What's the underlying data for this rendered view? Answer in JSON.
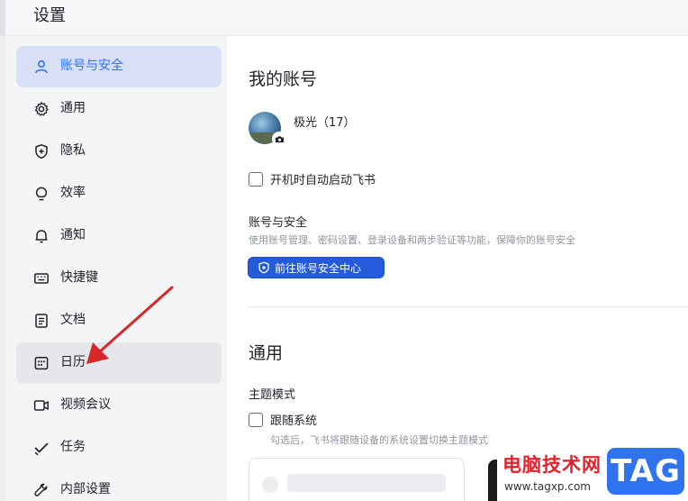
{
  "header": {
    "title": "设置"
  },
  "sidebar": {
    "items": [
      {
        "label": "账号与安全",
        "icon": "user-icon",
        "state": "active"
      },
      {
        "label": "通用",
        "icon": "gear-icon"
      },
      {
        "label": "隐私",
        "icon": "shield-icon"
      },
      {
        "label": "效率",
        "icon": "lightbulb-icon"
      },
      {
        "label": "通知",
        "icon": "bell-icon"
      },
      {
        "label": "快捷键",
        "icon": "keyboard-icon"
      },
      {
        "label": "文档",
        "icon": "document-icon"
      },
      {
        "label": "日历",
        "icon": "calendar-icon",
        "state": "hover"
      },
      {
        "label": "视频会议",
        "icon": "video-icon"
      },
      {
        "label": "任务",
        "icon": "checkmark-icon"
      },
      {
        "label": "内部设置",
        "icon": "wrench-icon"
      }
    ]
  },
  "account": {
    "section_title": "我的账号",
    "username": "极光（17）",
    "autostart_label": "开机时自动启动飞书",
    "security_title": "账号与安全",
    "security_desc": "使用账号管理、密码设置、登录设备和两步验证等功能，保障你的账号安全",
    "security_button": "前往账号安全中心"
  },
  "general": {
    "section_title": "通用",
    "theme_title": "主题模式",
    "follow_system_label": "跟随系统",
    "follow_system_desc": "勾选后，飞书将跟随设备的系统设置切换主题模式"
  },
  "watermark": {
    "title": "电脑技术网",
    "url": "www.tagxp.com",
    "logo": "TAG"
  },
  "colors": {
    "accent": "#3370ff",
    "button": "#245bdb",
    "annotation_arrow": "#d62828"
  }
}
